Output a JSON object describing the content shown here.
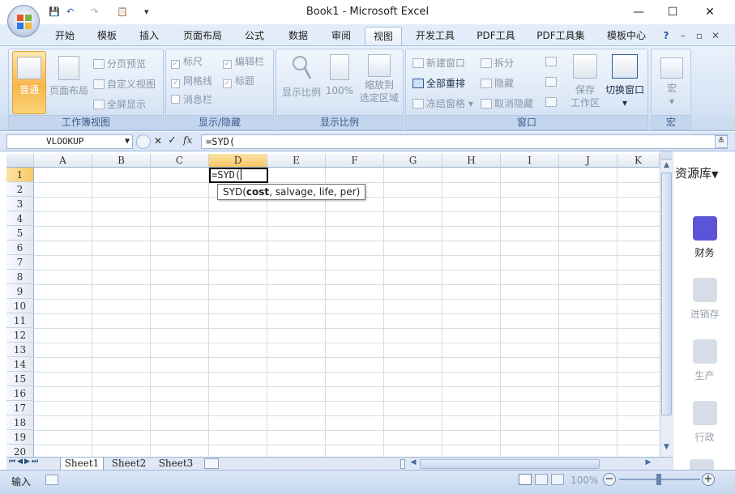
{
  "window": {
    "title": "Book1 - Microsoft Excel",
    "controls": {
      "minimize": "—",
      "maximize": "☐",
      "close": "✕"
    }
  },
  "quick_access": {
    "save": "💾",
    "undo": "↶",
    "redo": "↷",
    "paste": "📋",
    "more": "▾"
  },
  "tabs": [
    "开始",
    "模板",
    "插入",
    "页面布局",
    "公式",
    "数据",
    "审阅",
    "视图",
    "开发工具",
    "PDF工具",
    "PDF工具集",
    "模板中心"
  ],
  "active_tab": "视图",
  "tab_extras": {
    "help": "?",
    "min": "–",
    "restore": "▫",
    "close": "✕"
  },
  "ribbon": {
    "workbook_views": {
      "label": "工作簿视图",
      "normal": "普通",
      "page_layout": "页面布局",
      "page_break_preview": "分页预览",
      "custom_views": "自定义视图",
      "full_screen": "全屏显示"
    },
    "show_hide": {
      "label": "显示/隐藏",
      "ruler": "标尺",
      "gridlines": "网格线",
      "message_bar": "消息栏",
      "formula_bar": "编辑栏",
      "headings": "标题"
    },
    "zoom": {
      "label": "显示比例",
      "zoom": "显示比例",
      "hundred": "100%",
      "zoom_to_selection_1": "缩放到",
      "zoom_to_selection_2": "选定区域"
    },
    "window": {
      "label": "窗口",
      "new_window": "新建窗口",
      "arrange_all": "全部重排",
      "freeze_panes": "冻结窗格",
      "split": "拆分",
      "hide": "隐藏",
      "unhide": "取消隐藏",
      "save_workspace_1": "保存",
      "save_workspace_2": "工作区",
      "switch_windows": "切换窗口"
    },
    "macros": {
      "label": "宏",
      "macros": "宏"
    }
  },
  "formula_bar": {
    "name_box": "VLOOKUP",
    "cancel": "✕",
    "enter": "✓",
    "fx": "fx",
    "formula": "=SYD("
  },
  "grid": {
    "columns": [
      "A",
      "B",
      "C",
      "D",
      "E",
      "F",
      "G",
      "H",
      "I",
      "J",
      "K"
    ],
    "rows": [
      "1",
      "2",
      "3",
      "4",
      "5",
      "6",
      "7",
      "8",
      "9",
      "10",
      "11",
      "12",
      "13",
      "14",
      "15",
      "16",
      "17",
      "18",
      "19",
      "20"
    ],
    "selected_column": "D",
    "selected_row": "1",
    "active_cell_value": "=SYD("
  },
  "tooltip": {
    "func": "SYD(",
    "arg_bold": "cost",
    "rest": ", salvage, life, per)"
  },
  "side_panel": {
    "title": "资源库",
    "items": [
      "财务",
      "进销存",
      "生产",
      "行政"
    ]
  },
  "sheets": [
    "Sheet1",
    "Sheet2",
    "Sheet3"
  ],
  "status": {
    "mode": "输入",
    "zoom": "100%",
    "zoom_minus": "−",
    "zoom_plus": "+"
  },
  "colors": {
    "accent": "#2b579a",
    "selected_header": "#f8c763",
    "normal_view_active": "#f7b54a",
    "side_icon_active": "#5b54d6"
  }
}
